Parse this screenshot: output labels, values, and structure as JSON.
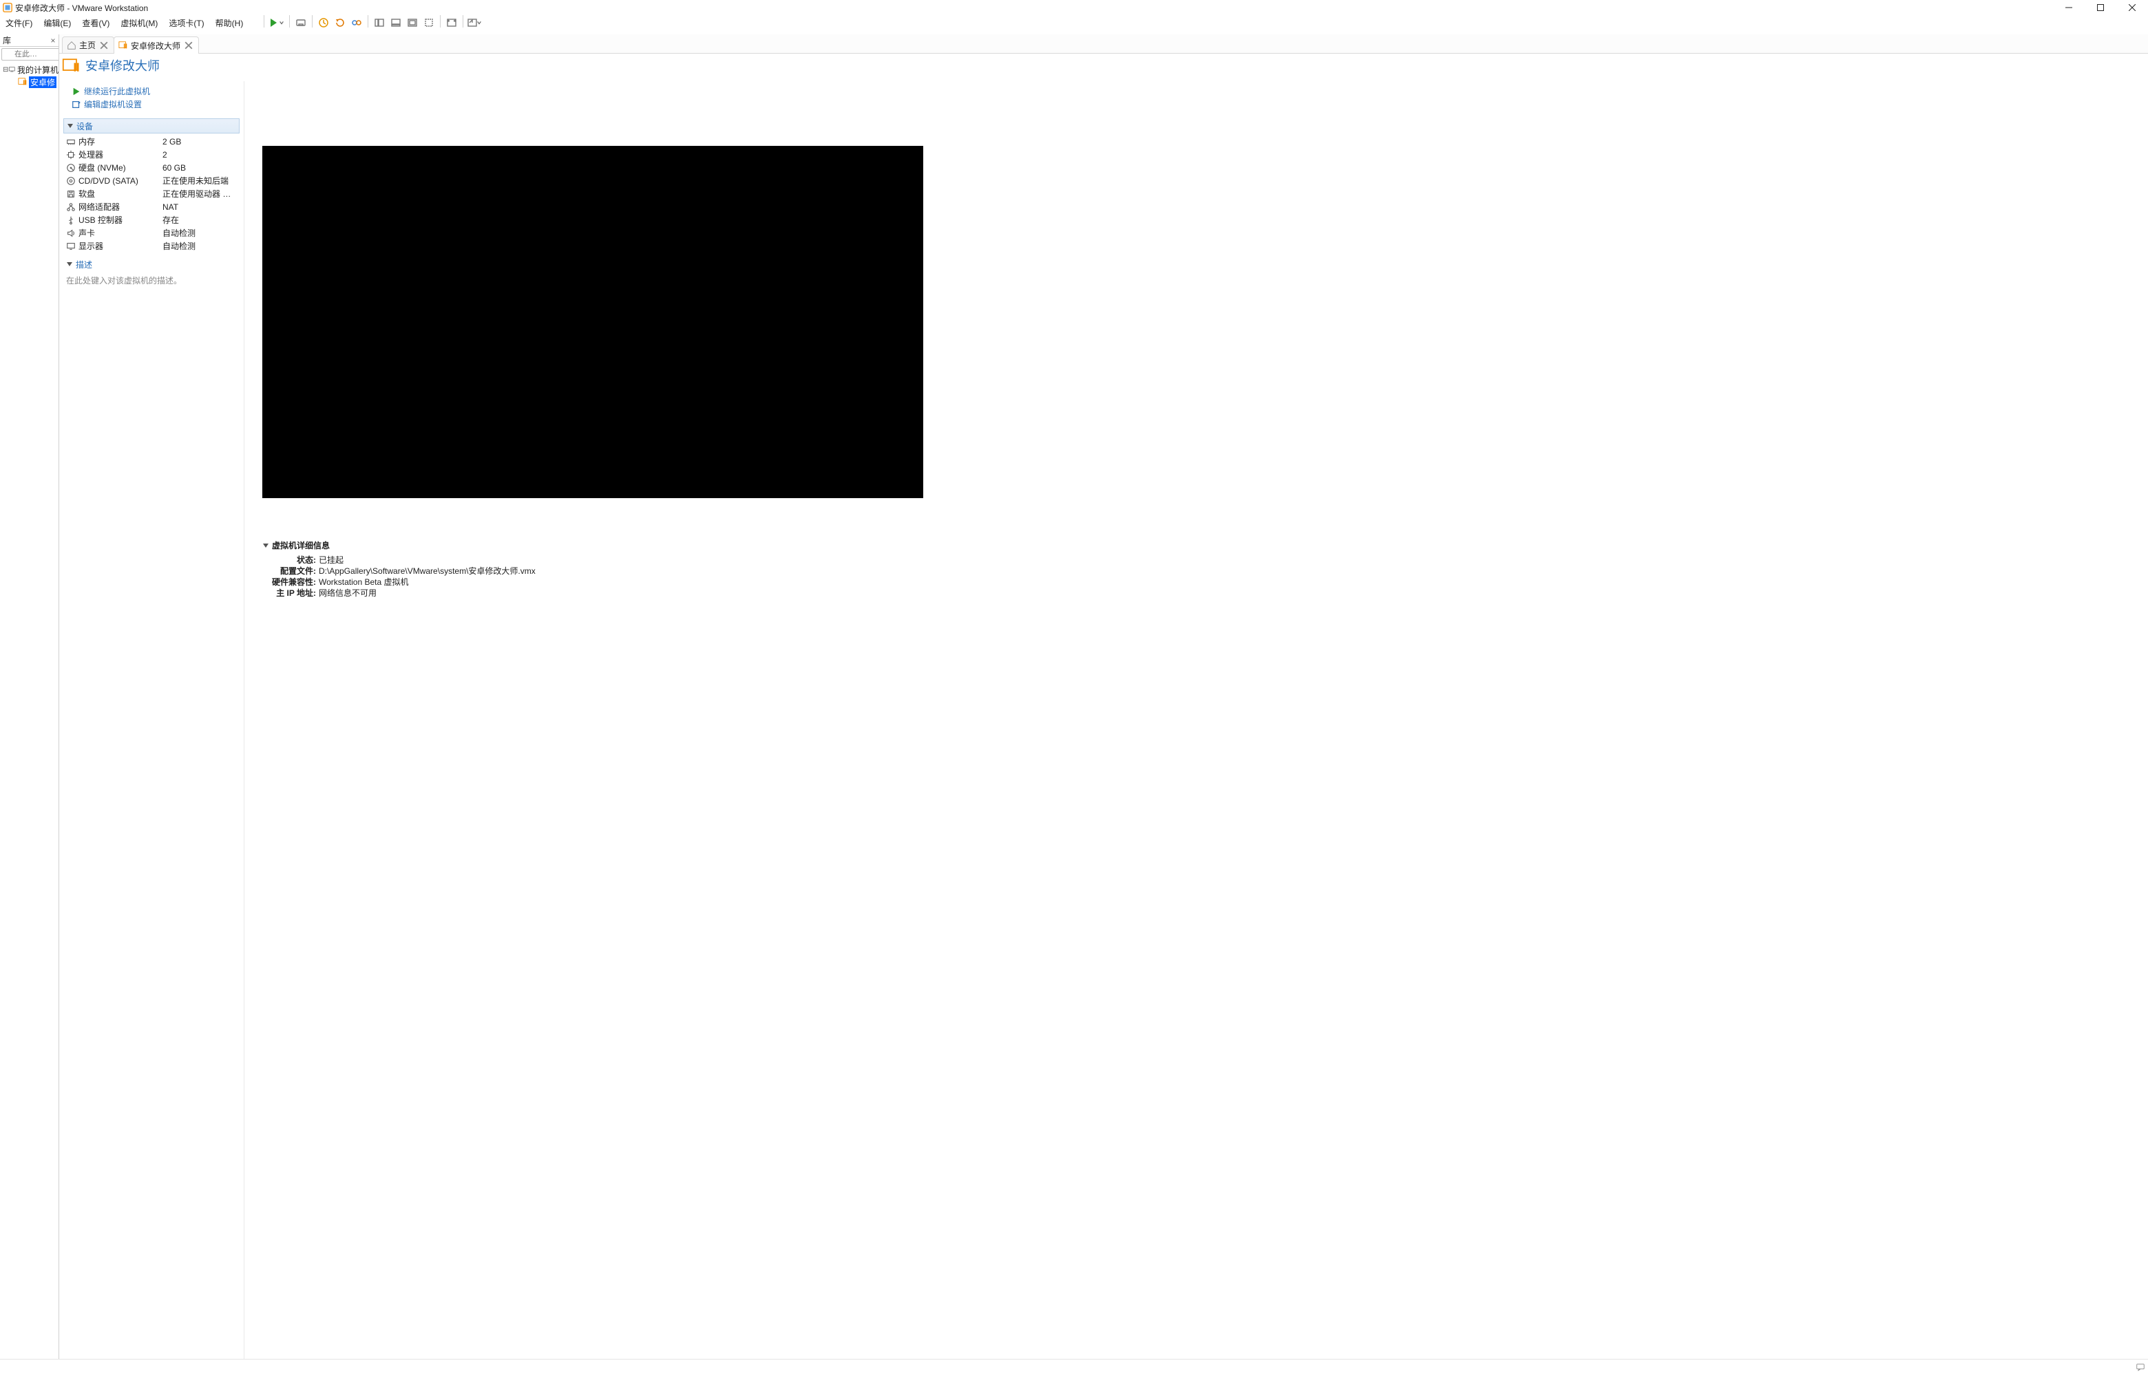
{
  "window": {
    "title": "安卓修改大师 - VMware Workstation"
  },
  "menus": [
    "文件(F)",
    "编辑(E)",
    "查看(V)",
    "虚拟机(M)",
    "选项卡(T)",
    "帮助(H)"
  ],
  "library": {
    "title": "库",
    "search_placeholder": "在此…",
    "tree": {
      "root": "我的计算机",
      "vm": "安卓修"
    }
  },
  "tabs": {
    "home": "主页",
    "vm": "安卓修改大师"
  },
  "vm": {
    "name": "安卓修改大师",
    "run_link": "继续运行此虚拟机",
    "edit_link": "编辑虚拟机设置"
  },
  "sections": {
    "devices": "设备",
    "description": "描述",
    "description_placeholder": "在此处键入对该虚拟机的描述。",
    "details": "虚拟机详细信息"
  },
  "devices": [
    {
      "icon": "memory",
      "name": "内存",
      "value": "2 GB"
    },
    {
      "icon": "cpu",
      "name": "处理器",
      "value": "2"
    },
    {
      "icon": "disk",
      "name": "硬盘 (NVMe)",
      "value": "60 GB"
    },
    {
      "icon": "cd",
      "name": "CD/DVD (SATA)",
      "value": "正在使用未知后端"
    },
    {
      "icon": "floppy",
      "name": "软盘",
      "value": "正在使用驱动器 …"
    },
    {
      "icon": "net",
      "name": "网络适配器",
      "value": "NAT"
    },
    {
      "icon": "usb",
      "name": "USB 控制器",
      "value": "存在"
    },
    {
      "icon": "sound",
      "name": "声卡",
      "value": "自动检测"
    },
    {
      "icon": "display",
      "name": "显示器",
      "value": "自动检测"
    }
  ],
  "details": [
    {
      "k": "状态:",
      "v": "已挂起"
    },
    {
      "k": "配置文件:",
      "v": "D:\\AppGallery\\Software\\VMware\\system\\安卓修改大师.vmx"
    },
    {
      "k": "硬件兼容性:",
      "v": "Workstation Beta 虚拟机"
    },
    {
      "k": "主 IP 地址:",
      "v": "网络信息不可用"
    }
  ]
}
